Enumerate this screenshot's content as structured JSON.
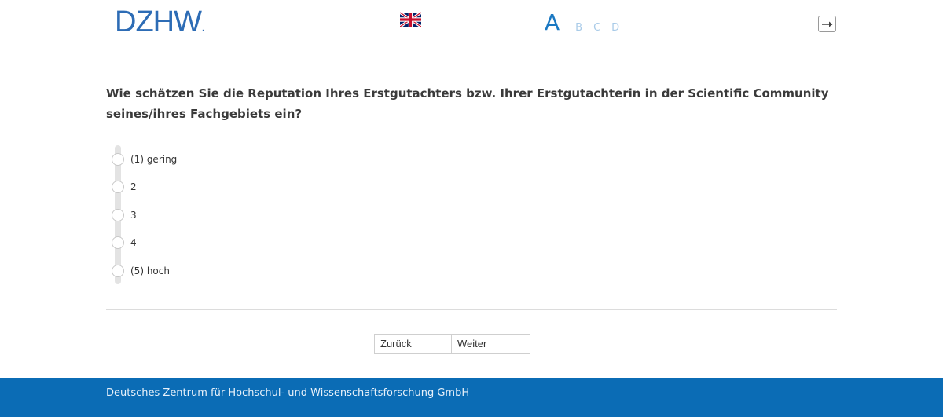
{
  "header": {
    "logo_text": "DZHW",
    "logo_dot": ".",
    "language_flag": "uk-flag-icon",
    "steps": [
      {
        "label": "A",
        "active": true
      },
      {
        "label": "B",
        "active": false
      },
      {
        "label": "C",
        "active": false
      },
      {
        "label": "D",
        "active": false
      }
    ],
    "exit_icon": "exit-arrow-icon"
  },
  "question": {
    "text": "Wie schätzen Sie die Reputation Ihres Erstgutachters bzw. Ihrer Erstgutachterin in der Scientific Community seines/ihres Fachgebiets ein?"
  },
  "options": [
    {
      "label": "(1) gering"
    },
    {
      "label": "2"
    },
    {
      "label": "3"
    },
    {
      "label": "4"
    },
    {
      "label": "(5) hoch"
    }
  ],
  "navigation": {
    "back_label": "Zurück",
    "next_label": "Weiter"
  },
  "footer": {
    "text": "Deutsches Zentrum für Hochschul- und Wissenschaftsforschung GmbH"
  },
  "colors": {
    "brand_blue": "#0b6cb5",
    "logo_blue": "#2d6cb5",
    "step_active": "#1a78c2",
    "step_inactive": "#a9cbe8"
  }
}
